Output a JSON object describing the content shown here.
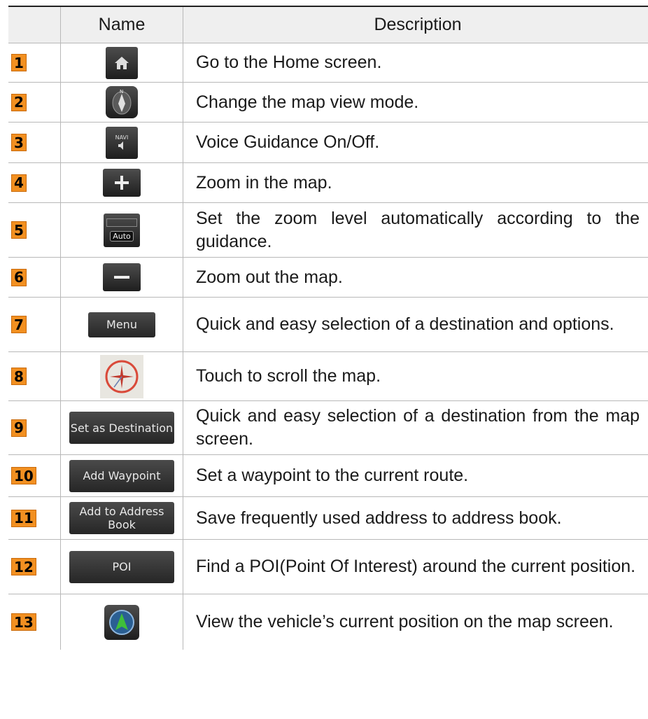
{
  "header": {
    "name": "Name",
    "description": "Description"
  },
  "rows": [
    {
      "num": "1",
      "icon": "home-icon",
      "description": "Go to the Home screen."
    },
    {
      "num": "2",
      "icon": "compass-view-icon",
      "description": "Change the map view mode."
    },
    {
      "num": "3",
      "icon": "navi-voice-icon",
      "icon_text": "NAVI",
      "description": "Voice Guidance On/Off."
    },
    {
      "num": "4",
      "icon": "zoom-in-icon",
      "description": "Zoom in the map."
    },
    {
      "num": "5",
      "icon": "auto-zoom-icon",
      "icon_text": "Auto",
      "description": "Set the zoom level automatically according to the guidance."
    },
    {
      "num": "6",
      "icon": "zoom-out-icon",
      "description": "Zoom out the map."
    },
    {
      "num": "7",
      "button": "Menu",
      "description": "Quick and easy selection of a destination and options."
    },
    {
      "num": "8",
      "icon": "scroll-cursor-icon",
      "description": "Touch to scroll the map."
    },
    {
      "num": "9",
      "button": "Set as Destination",
      "description": "Quick and easy selection of a destination from the map screen."
    },
    {
      "num": "10",
      "button": "Add Waypoint",
      "description": "Set a waypoint to the current route."
    },
    {
      "num": "11",
      "button": "Add to Address Book",
      "description": "Save frequently used address to address book."
    },
    {
      "num": "12",
      "button": "POI",
      "description": "Find a POI(Point Of Interest) around the current position."
    },
    {
      "num": "13",
      "icon": "current-position-icon",
      "description": "View the vehicle’s current position on the map screen."
    }
  ],
  "colors": {
    "badge": "#f29021",
    "header_bg": "#efefef",
    "button_bg": "#333333"
  }
}
